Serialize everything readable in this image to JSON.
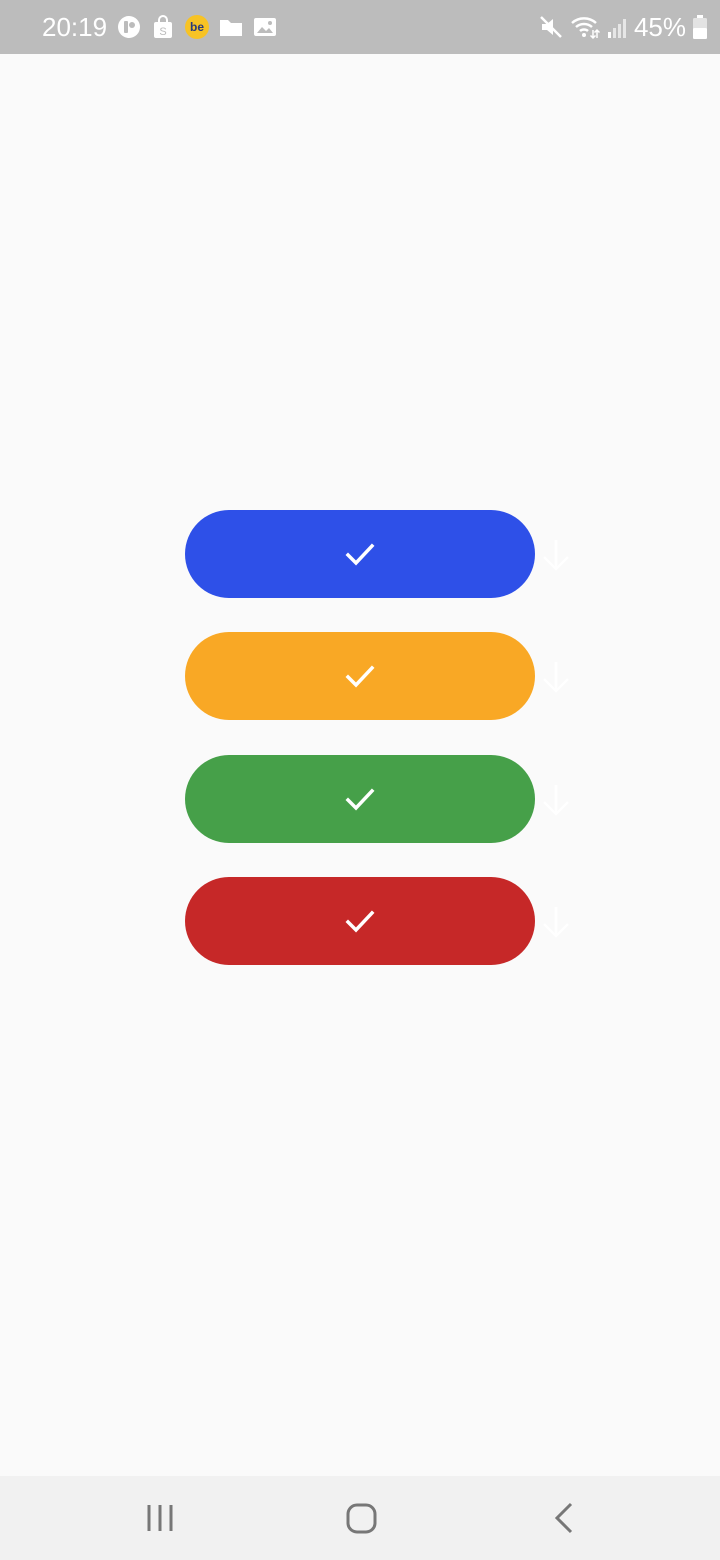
{
  "status_bar": {
    "time": "20:19",
    "battery_percent": "45%",
    "left_icons": [
      "record-icon",
      "shopping-bag-icon",
      "be-app-icon",
      "folder-icon",
      "gallery-icon"
    ],
    "right_icons": [
      "mute-icon",
      "wifi-icon",
      "signal-icon",
      "battery-icon"
    ],
    "background": "#bcbcbc",
    "be_badge_text": "be",
    "shop_badge_text": "S"
  },
  "buttons": [
    {
      "color": "#2e50e8",
      "icon": "checkmark-icon",
      "side_icon": "arrow-down-icon"
    },
    {
      "color": "#f9a825",
      "icon": "checkmark-icon",
      "side_icon": "arrow-down-icon"
    },
    {
      "color": "#46a049",
      "icon": "checkmark-icon",
      "side_icon": "arrow-down-icon"
    },
    {
      "color": "#c62828",
      "icon": "checkmark-icon",
      "side_icon": "arrow-down-icon"
    }
  ],
  "nav_bar": {
    "items": [
      "recent-apps-icon",
      "home-icon",
      "back-icon"
    ],
    "background": "#f1f1f1"
  },
  "page": {
    "background": "#fafafa"
  }
}
